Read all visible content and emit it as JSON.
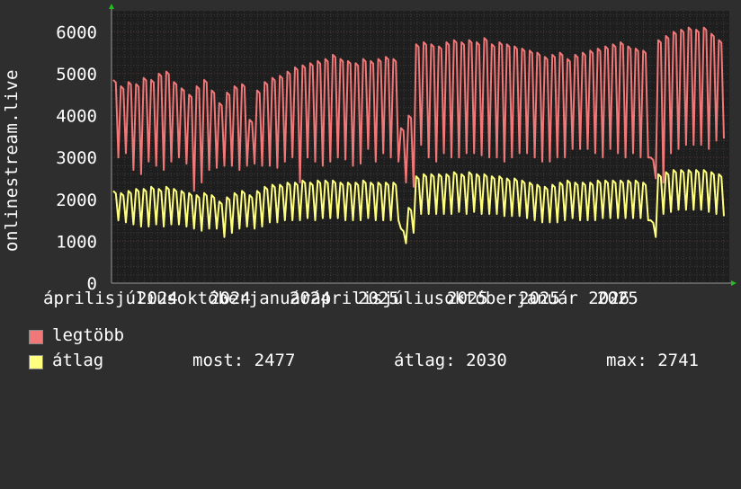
{
  "chart_data": {
    "type": "line",
    "ylabel": "onlinestream.live",
    "ylim": [
      0,
      6500
    ],
    "yticks": [
      0,
      1000,
      2000,
      3000,
      4000,
      5000,
      6000
    ],
    "xtick_labels": [
      "április",
      "július",
      "október",
      "január",
      "április",
      "július",
      "október",
      "január",
      "2024",
      "2024",
      "2024",
      "2025",
      "2025",
      "2025",
      "2025",
      "2026"
    ],
    "x_axis_text": "áprilisjúliusoktóberjanuáráprilisjúliusoktóberjanuár 2026 2024 2024 2024 2025 2025 2025 2025",
    "x_range": [
      "2024-04",
      "2026-01"
    ],
    "grid": true,
    "series": [
      {
        "name": "legtöbb",
        "color": "#f07878",
        "weekly_pattern_note": "",
        "values": [
          4850,
          4700,
          4800,
          4750,
          4900,
          4850,
          5000,
          5050,
          4800,
          4650,
          4500,
          4700,
          4850,
          4600,
          4300,
          4550,
          4700,
          4750,
          3900,
          4600,
          4800,
          4900,
          4950,
          5050,
          5150,
          5200,
          5250,
          5300,
          5350,
          5450,
          5350,
          5300,
          5250,
          5350,
          5300,
          5350,
          5400,
          5350,
          3700,
          4000,
          5700,
          5750,
          5700,
          5650,
          5750,
          5800,
          5750,
          5800,
          5750,
          5850,
          5700,
          5750,
          5700,
          5650,
          5600,
          5550,
          5500,
          5400,
          5450,
          5500,
          5350,
          5450,
          5500,
          5550,
          5600,
          5650,
          5700,
          5750,
          5650,
          5600,
          5550,
          3000,
          5800,
          5900,
          6000,
          6050,
          6100,
          6050,
          6100,
          5950,
          5800
        ],
        "dip_values": [
          3000,
          3100,
          2700,
          2600,
          2900,
          2800,
          2700,
          2900,
          3000,
          2850,
          2200,
          2400,
          2700,
          2750,
          2800,
          2800,
          2700,
          2800,
          2850,
          2800,
          2800,
          2750,
          2900,
          3000,
          2400,
          3000,
          2900,
          2800,
          2900,
          3000,
          2950,
          2800,
          2850,
          3200,
          2900,
          3100,
          3000,
          2900,
          2400,
          2300,
          3300,
          3000,
          2900,
          3100,
          3000,
          3000,
          3100,
          3100,
          3050,
          3000,
          3000,
          2900,
          3000,
          3100,
          3100,
          3000,
          2900,
          2900,
          3000,
          3000,
          3200,
          3200,
          3200,
          3100,
          3000,
          3200,
          3100,
          3000,
          3100,
          3000,
          3000,
          2500,
          2400,
          3100,
          3200,
          3300,
          3300,
          3300,
          3200,
          3400,
          3450
        ]
      },
      {
        "name": "átlag",
        "color": "#ffff80",
        "values": [
          2200,
          2150,
          2200,
          2250,
          2250,
          2300,
          2250,
          2300,
          2250,
          2200,
          2150,
          2100,
          2150,
          2100,
          1950,
          2050,
          2150,
          2200,
          2100,
          2200,
          2300,
          2350,
          2350,
          2400,
          2400,
          2450,
          2400,
          2450,
          2450,
          2450,
          2400,
          2400,
          2400,
          2450,
          2400,
          2400,
          2400,
          2400,
          1300,
          1800,
          2550,
          2600,
          2600,
          2600,
          2600,
          2650,
          2600,
          2650,
          2600,
          2600,
          2550,
          2550,
          2500,
          2500,
          2450,
          2400,
          2350,
          2300,
          2350,
          2400,
          2450,
          2400,
          2400,
          2400,
          2450,
          2450,
          2450,
          2450,
          2450,
          2450,
          2400,
          1500,
          2600,
          2650,
          2700,
          2700,
          2700,
          2700,
          2700,
          2650,
          2600
        ],
        "dip_values": [
          1500,
          1450,
          1400,
          1350,
          1350,
          1400,
          1350,
          1400,
          1400,
          1350,
          1300,
          1250,
          1300,
          1300,
          1100,
          1200,
          1300,
          1350,
          1300,
          1350,
          1450,
          1450,
          1500,
          1500,
          1500,
          1550,
          1500,
          1550,
          1550,
          1550,
          1500,
          1500,
          1500,
          1550,
          1500,
          1500,
          1500,
          1500,
          950,
          1200,
          1650,
          1650,
          1650,
          1650,
          1650,
          1700,
          1650,
          1700,
          1650,
          1650,
          1650,
          1600,
          1600,
          1600,
          1550,
          1500,
          1450,
          1450,
          1450,
          1500,
          1550,
          1500,
          1500,
          1500,
          1550,
          1550,
          1550,
          1550,
          1550,
          1550,
          1500,
          1100,
          1650,
          1700,
          1750,
          1750,
          1750,
          1750,
          1700,
          1650,
          1600
        ]
      }
    ]
  },
  "legend": {
    "max_label": "legtöbb",
    "avg_label": "átlag",
    "stat_now": "most: 2477",
    "stat_avg": "átlag: 2030",
    "stat_max": "max: 2741"
  },
  "colors": {
    "background": "#2e2e2e",
    "plot_bg": "#1e1e1e",
    "grid": "#5a3030",
    "axis": "#9a9a9a",
    "max_line": "#f07878",
    "avg_line": "#ffff80",
    "arrow": "#20c020"
  }
}
